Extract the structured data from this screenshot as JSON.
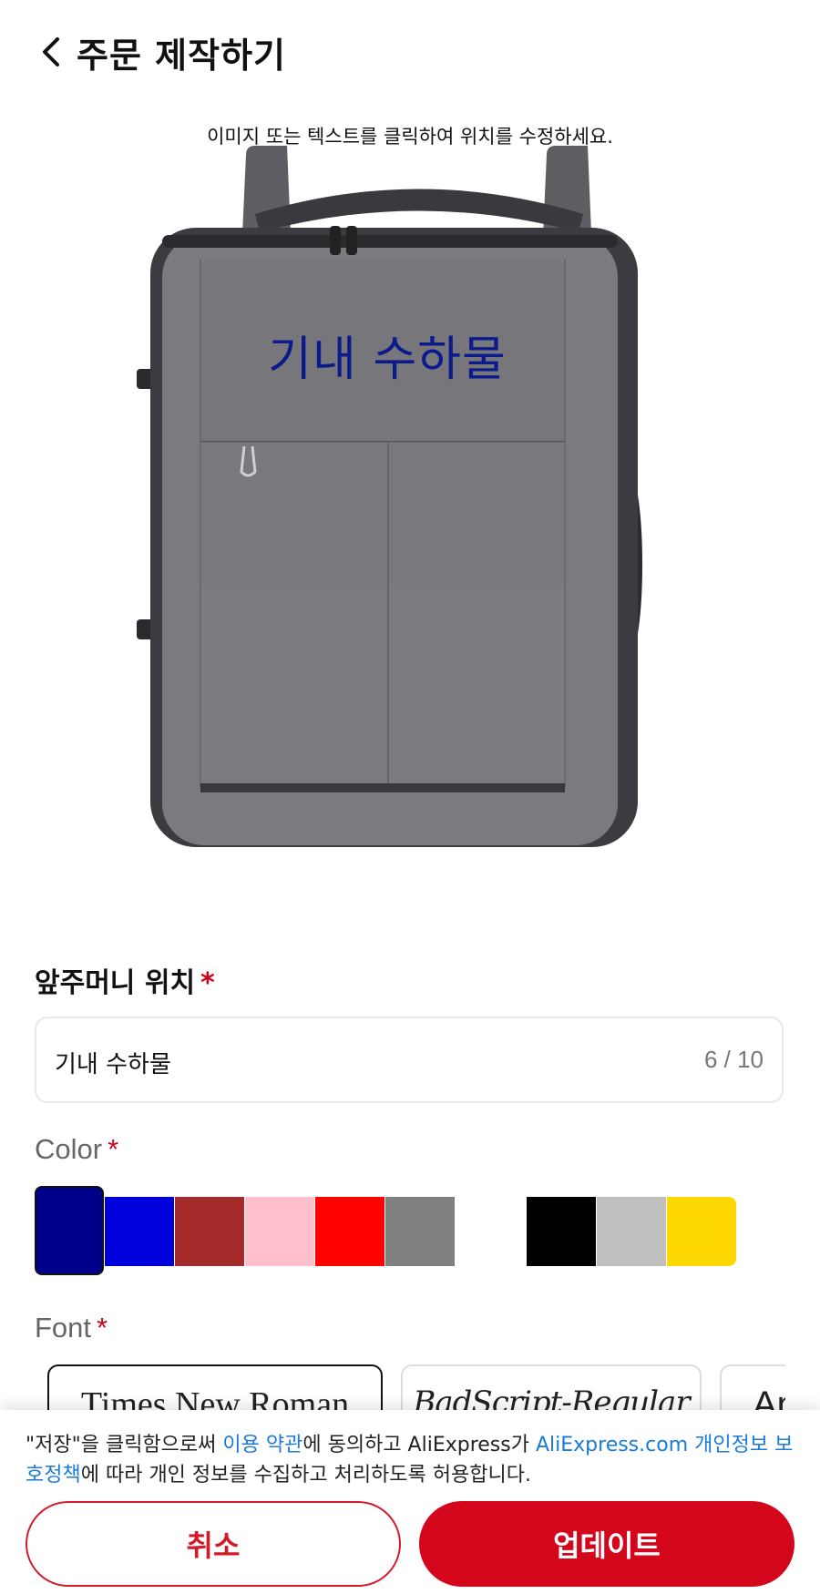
{
  "header": {
    "title": "주문 제작하기"
  },
  "preview": {
    "hint": "이미지 또는 텍스트를 클릭하여 위치를 수정하세요.",
    "overlay_text": "기내 수하물",
    "overlay_color": "#0b1a8c"
  },
  "position_field": {
    "label": "앞주머니 위치",
    "required_mark": "*",
    "value": "기내 수하물",
    "count": "6 / 10"
  },
  "color_field": {
    "label": "Color",
    "required_mark": "*",
    "options": [
      "#00008b",
      "#0000dd",
      "#a52a2a",
      "#ffc0cb",
      "#ff0000",
      "#808080",
      "#ffffff",
      "#000000",
      "#c0c0c0",
      "#ffd700"
    ],
    "selected_index": 0
  },
  "font_field": {
    "label": "Font",
    "required_mark": "*",
    "options": [
      "Times New Roman",
      "BadScript-Regular",
      "An"
    ],
    "selected_index": 0
  },
  "footer": {
    "notice_part1": "\"저장\"을 클릭함으로써 ",
    "terms_link": "이용 약관",
    "notice_part2": "에 동의하고 AliExpress가 ",
    "privacy_link": "AliExpress.com 개인정보 보호정책",
    "notice_part3": "에 따라 개인 정보를 수집하고 처리하도록 허용합니다.",
    "cancel_label": "취소",
    "update_label": "업데이트"
  }
}
